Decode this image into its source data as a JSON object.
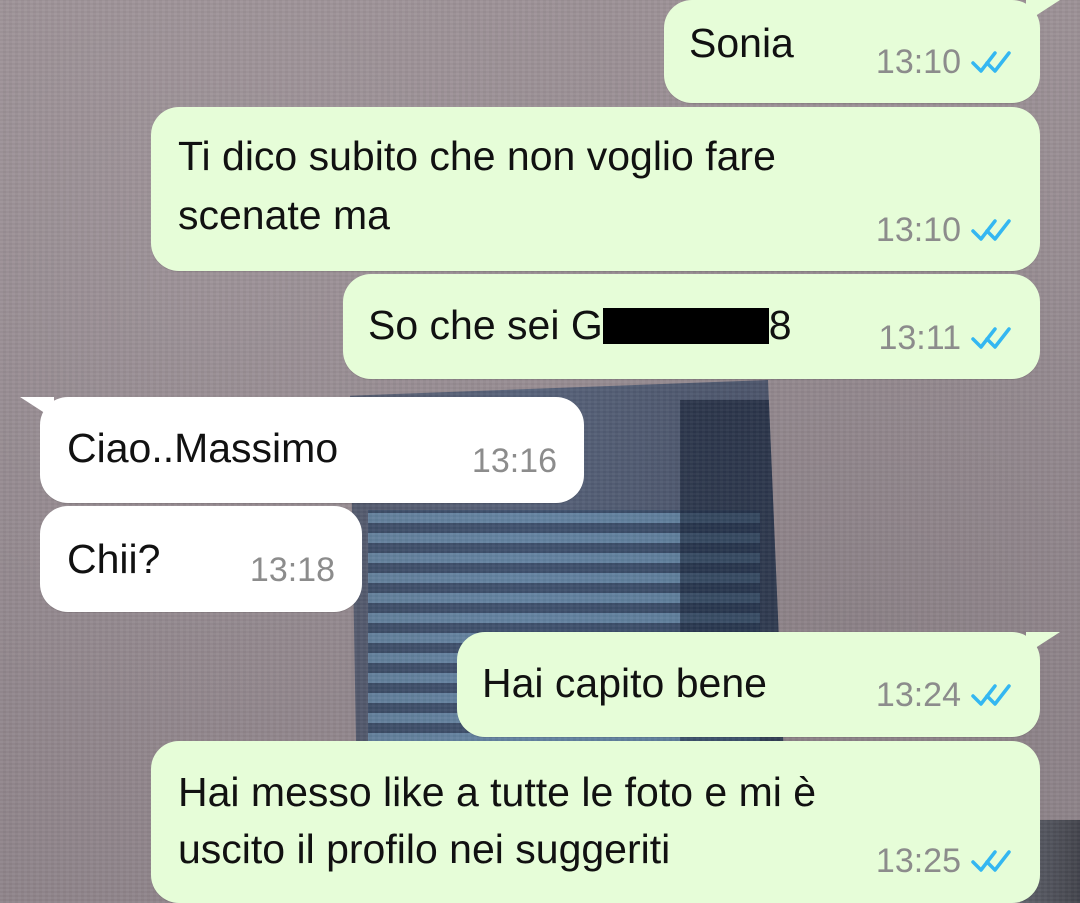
{
  "messages": [
    {
      "id": "m1",
      "direction": "outgoing",
      "text_line1": "Sonia",
      "time": "13:10",
      "status": "read",
      "status_color": "#34b7f1"
    },
    {
      "id": "m2",
      "direction": "outgoing",
      "text_line1": "Ti dico subito che non voglio fare",
      "text_line2": "scenate ma",
      "time": "13:10",
      "status": "read",
      "status_color": "#34b7f1"
    },
    {
      "id": "m3",
      "direction": "outgoing",
      "text_prefix": "So che sei G",
      "text_suffix": "8",
      "redacted": true,
      "time": "13:11",
      "status": "read",
      "status_color": "#34b7f1"
    },
    {
      "id": "m4",
      "direction": "incoming",
      "text_line1": "Ciao..Massimo",
      "time": "13:16"
    },
    {
      "id": "m5",
      "direction": "incoming",
      "text_line1": "Chii?",
      "time": "13:18"
    },
    {
      "id": "m6",
      "direction": "outgoing",
      "text_line1": "Hai capito bene",
      "time": "13:24",
      "status": "read",
      "status_color": "#34b7f1"
    },
    {
      "id": "m7",
      "direction": "outgoing",
      "text_line1": "Hai messo like a tutte le foto e mi è",
      "text_line2": "uscito il profilo nei suggeriti",
      "time": "13:25",
      "status": "read",
      "status_color": "#34b7f1"
    }
  ],
  "icons": {
    "read_receipt": "double-check-icon"
  },
  "colors": {
    "outgoing_bubble": "#e6fdd8",
    "incoming_bubble": "#ffffff",
    "timestamp": "#8c8c8c",
    "read_receipt": "#34b7f1"
  }
}
